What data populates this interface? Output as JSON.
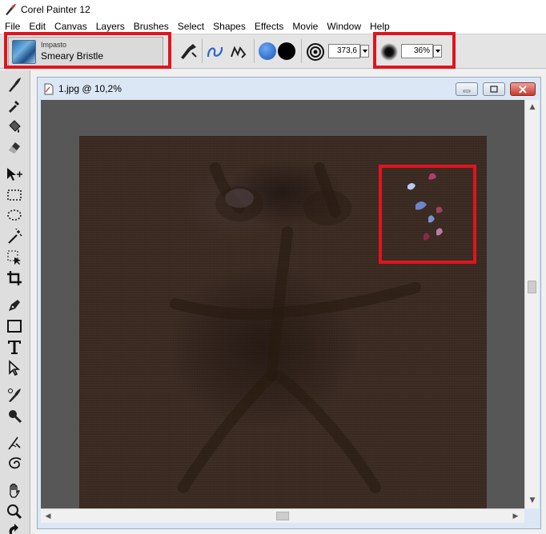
{
  "app": {
    "title": "Corel Painter 12",
    "accent_color": "#3a7bd5"
  },
  "menu": {
    "items": [
      "File",
      "Edit",
      "Canvas",
      "Layers",
      "Brushes",
      "Select",
      "Shapes",
      "Effects",
      "Movie",
      "Window",
      "Help"
    ]
  },
  "property_bar": {
    "brush_category": "Impasto",
    "brush_variant": "Smeary Bristle",
    "main_color": "#3a7bd5",
    "additional_color": "#000000",
    "size_value": "373,6",
    "opacity_value": "36%"
  },
  "toolbox": {
    "tools": [
      "brush-icon",
      "dropper-icon",
      "paint-bucket-icon",
      "eraser-icon",
      "layer-adjuster-icon",
      "rect-select-icon",
      "lasso-icon",
      "magic-wand-icon",
      "transform-icon",
      "crop-icon",
      "pen-icon",
      "rectangle-icon",
      "text-icon",
      "shape-selection-icon",
      "cloner-icon",
      "rubber-stamp-icon",
      "dodge-icon",
      "divine-proportion-icon",
      "grabber-icon",
      "magnifier-icon",
      "rotate-page-icon"
    ]
  },
  "document": {
    "title": "1.jpg @ 10,2%",
    "highlight_color": "#e0141e"
  }
}
